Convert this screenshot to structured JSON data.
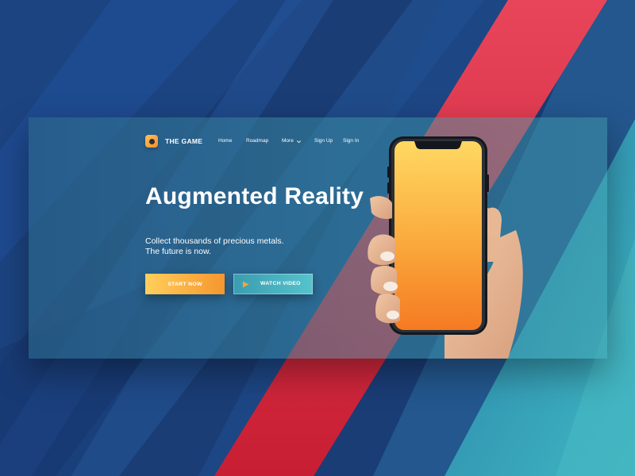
{
  "brand": {
    "name": "THE GAME",
    "logo_icon": "game-logo-icon"
  },
  "nav": {
    "items": [
      {
        "label": "Home"
      },
      {
        "label": "Roadmap"
      },
      {
        "label": "More",
        "icon": "chevron-down-icon"
      },
      {
        "label": "Sign Up"
      },
      {
        "label": "Sign In"
      }
    ]
  },
  "hero": {
    "headline": "Augmented Reality",
    "subtitle_lines": [
      "Collect thousands of precious metals.",
      "The future is now."
    ],
    "primary_cta": "START NOW",
    "secondary_cta": "WATCH VIDEO",
    "secondary_cta_icon": "play-icon"
  },
  "colors": {
    "background": "#1b3f77",
    "accent_red": "#d5283f",
    "accent_orange": "#f5962e",
    "accent_yellow": "#ffcf5c",
    "accent_teal": "#56c3cd"
  }
}
